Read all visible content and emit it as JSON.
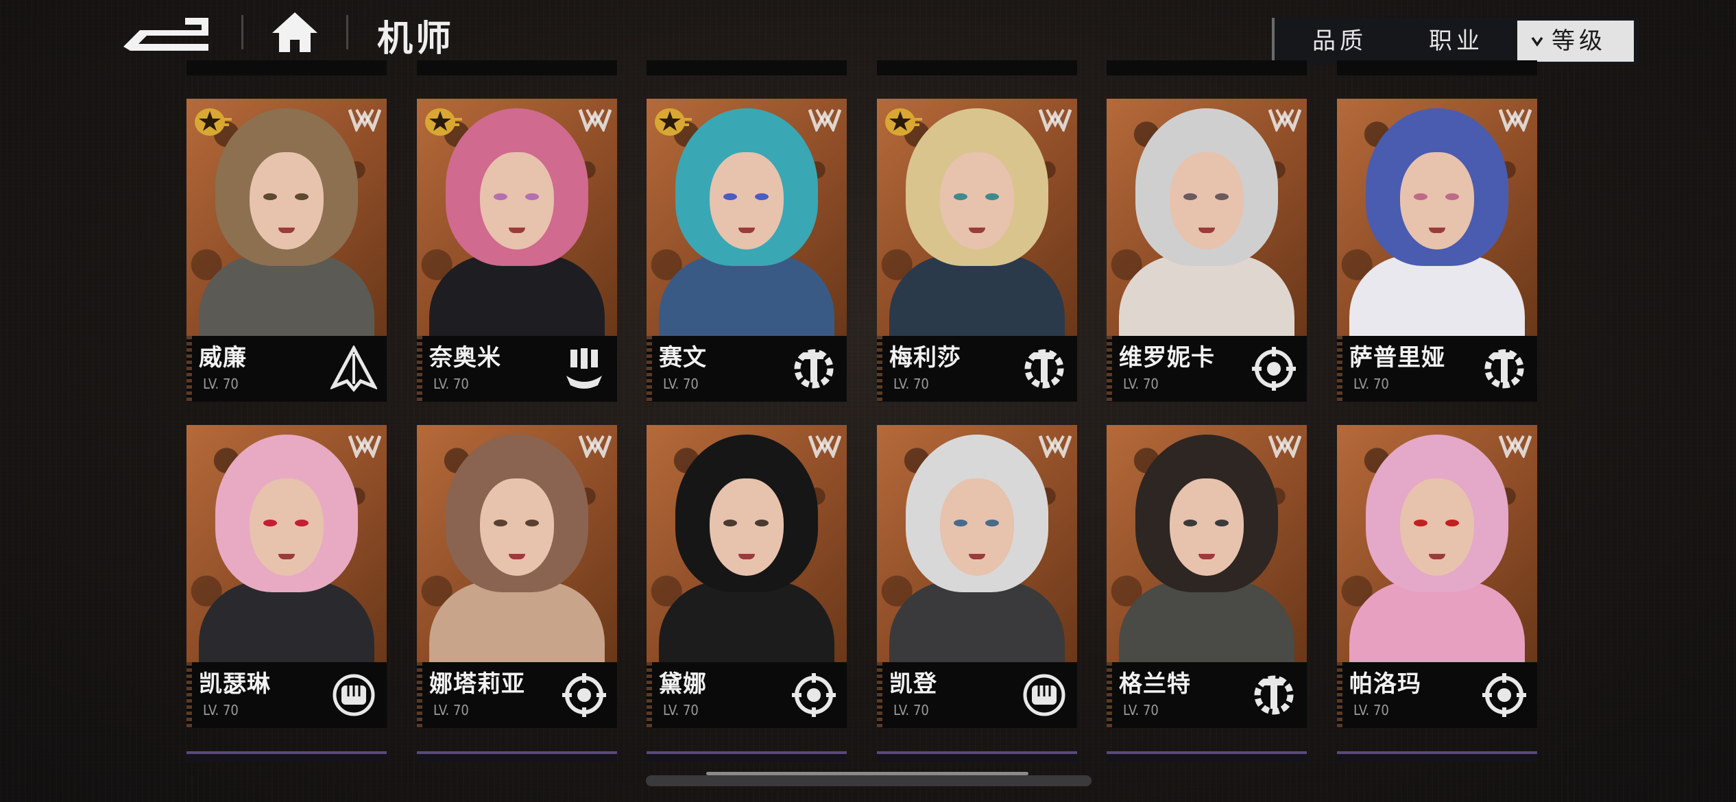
{
  "header": {
    "title": "机师"
  },
  "sort": {
    "quality": "品质",
    "job": "职业",
    "level": "等级",
    "active": "level"
  },
  "colors": {
    "card_bg": "#b56a3a",
    "accent_star": "#e0b43a",
    "info_bg": "#0a0a0a"
  },
  "cards": [
    {
      "name": "威廉",
      "level": "LV. 70",
      "star": true,
      "class_icon": "arrowhead-icon",
      "hair": "#8c7050",
      "eye": "#5a4a30",
      "body": "#5c5a55"
    },
    {
      "name": "奈奥米",
      "level": "LV. 70",
      "star": true,
      "class_icon": "cannon-icon",
      "hair": "#d06a8e",
      "eye": "#b36fb0",
      "body": "#1e1e22"
    },
    {
      "name": "赛文",
      "level": "LV. 70",
      "star": true,
      "class_icon": "wrench-gear-icon",
      "hair": "#3aa7b4",
      "eye": "#4a5dc4",
      "body": "#3a5a86"
    },
    {
      "name": "梅利莎",
      "level": "LV. 70",
      "star": true,
      "class_icon": "wrench-gear-icon",
      "hair": "#d9c48e",
      "eye": "#3f8a8e",
      "body": "#2a3a4a"
    },
    {
      "name": "维罗妮卡",
      "level": "LV. 70",
      "star": false,
      "class_icon": "target-icon",
      "hair": "#cfcfcf",
      "eye": "#6a5a60",
      "body": "#e0d6d0"
    },
    {
      "name": "萨普里娅",
      "level": "LV. 70",
      "star": false,
      "class_icon": "wrench-gear-icon",
      "hair": "#4a5cb0",
      "eye": "#c06a8a",
      "body": "#e8e8ee"
    },
    {
      "name": "凯瑟琳",
      "level": "LV. 70",
      "star": false,
      "class_icon": "fist-icon",
      "hair": "#e7aac2",
      "eye": "#c02030",
      "body": "#2a2a2e"
    },
    {
      "name": "娜塔莉亚",
      "level": "LV. 70",
      "star": false,
      "class_icon": "target-icon",
      "hair": "#8a6450",
      "eye": "#5a4030",
      "body": "#c8a48a"
    },
    {
      "name": "黛娜",
      "level": "LV. 70",
      "star": false,
      "class_icon": "target-icon",
      "hair": "#161616",
      "eye": "#4a3a30",
      "body": "#1c1c1c"
    },
    {
      "name": "凯登",
      "level": "LV. 70",
      "star": false,
      "class_icon": "fist-icon",
      "hair": "#d8d8d8",
      "eye": "#4a6a8a",
      "body": "#3a3a3c"
    },
    {
      "name": "格兰特",
      "level": "LV. 70",
      "star": false,
      "class_icon": "wrench-gear-icon",
      "hair": "#2e2622",
      "eye": "#3a3a3a",
      "body": "#4a4a46"
    },
    {
      "name": "帕洛玛",
      "level": "LV. 70",
      "star": false,
      "class_icon": "target-icon",
      "hair": "#e4a8c8",
      "eye": "#c02020",
      "body": "#e8a0c0"
    }
  ]
}
